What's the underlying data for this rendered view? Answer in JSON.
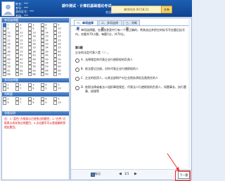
{
  "header": {
    "candidate_lines": [
      "姓名：***",
      "考号：***",
      "身份证号：***",
      "考场：***"
    ],
    "exam_title": "期中测试 · 计算机基础理论考试",
    "exam_subtitle": "考试进行中",
    "timer_text": "剩余时间 00:58:21",
    "button_label": "交卷"
  },
  "left_panel": {
    "section1_title": "单项选择题",
    "section1_items": [
      {
        "label": "1",
        "done": true
      },
      {
        "label": "2",
        "done": false
      },
      {
        "label": "3",
        "done": false
      },
      {
        "label": "4",
        "done": false
      },
      {
        "label": "5",
        "done": false
      },
      {
        "label": "6",
        "done": false
      },
      {
        "label": "7",
        "done": false
      },
      {
        "label": "8",
        "done": false
      },
      {
        "label": "9",
        "done": false
      },
      {
        "label": "10",
        "done": false
      },
      {
        "label": "11",
        "done": false
      },
      {
        "label": "12",
        "done": false
      },
      {
        "label": "13",
        "done": false
      },
      {
        "label": "14",
        "done": false
      },
      {
        "label": "15",
        "done": false
      },
      {
        "label": "16",
        "done": false
      },
      {
        "label": "17",
        "done": false
      },
      {
        "label": "18",
        "done": false
      },
      {
        "label": "19",
        "done": false
      },
      {
        "label": "20",
        "done": false
      },
      {
        "label": "21",
        "done": false
      },
      {
        "label": "22",
        "done": false
      },
      {
        "label": "23",
        "done": false
      },
      {
        "label": "24",
        "done": false
      },
      {
        "label": "25",
        "done": false
      },
      {
        "label": "26",
        "done": false
      },
      {
        "label": "27",
        "done": false
      },
      {
        "label": "28",
        "done": false
      },
      {
        "label": "29",
        "done": false
      },
      {
        "label": "30",
        "done": false
      },
      {
        "label": "31",
        "done": false
      },
      {
        "label": "32",
        "done": false
      },
      {
        "label": "33",
        "done": false
      },
      {
        "label": "34",
        "done": false
      },
      {
        "label": "35",
        "done": false
      },
      {
        "label": "36",
        "done": false
      },
      {
        "label": "37",
        "done": false
      },
      {
        "label": "38",
        "done": false
      },
      {
        "label": "39",
        "done": false
      },
      {
        "label": "40",
        "done": false
      },
      {
        "label": "41",
        "done": false
      },
      {
        "label": "42",
        "done": false
      },
      {
        "label": "43",
        "done": false
      },
      {
        "label": "44",
        "done": false
      },
      {
        "label": "45",
        "done": false
      },
      {
        "label": "46",
        "done": false
      },
      {
        "label": "47",
        "done": false
      },
      {
        "label": "48",
        "done": false
      },
      {
        "label": "49",
        "done": false
      },
      {
        "label": "50",
        "done": false
      },
      {
        "label": "51",
        "done": false
      },
      {
        "label": "52",
        "done": false
      },
      {
        "label": "53",
        "done": false
      },
      {
        "label": "54",
        "done": false
      },
      {
        "label": "55",
        "done": false
      },
      {
        "label": "56",
        "done": false
      },
      {
        "label": "57",
        "done": false
      },
      {
        "label": "58",
        "done": false
      },
      {
        "label": "59",
        "done": false
      },
      {
        "label": "60",
        "done": false
      },
      {
        "label": "61",
        "done": false
      },
      {
        "label": "62",
        "done": false
      },
      {
        "label": "63",
        "done": false
      },
      {
        "label": "64",
        "done": false
      },
      {
        "label": "65",
        "done": false
      },
      {
        "label": "66",
        "done": false
      },
      {
        "label": "67",
        "done": false
      },
      {
        "label": "68",
        "done": false
      },
      {
        "label": "69",
        "done": false
      },
      {
        "label": "70",
        "done": false
      }
    ],
    "section2_title": "多项选择题",
    "section2_items": [
      {
        "label": "1",
        "done": false
      },
      {
        "label": "2",
        "done": false
      },
      {
        "label": "3",
        "done": false
      },
      {
        "label": "4",
        "done": false
      },
      {
        "label": "5",
        "done": false
      },
      {
        "label": "6",
        "done": false
      },
      {
        "label": "7",
        "done": false
      },
      {
        "label": "8",
        "done": false
      },
      {
        "label": "9",
        "done": false
      },
      {
        "label": "10",
        "done": false
      }
    ],
    "section3_title": "判断题",
    "section3_items": [
      {
        "label": "1",
        "done": false
      },
      {
        "label": "2",
        "done": false
      },
      {
        "label": "3",
        "done": false
      },
      {
        "label": "4",
        "done": false
      },
      {
        "label": "5",
        "done": false
      },
      {
        "label": "6",
        "done": false
      },
      {
        "label": "7",
        "done": false
      },
      {
        "label": "8",
        "done": false
      },
      {
        "label": "9",
        "done": false
      },
      {
        "label": "10",
        "done": false
      }
    ],
    "notice_title": "答题说明",
    "notice_text": "注：1.“蓝色”方框表示已经答过的题目；2.“白色”方框表示尚未答过的题目；3.点击题号可以直接跳转到相应题目。"
  },
  "right_panel": {
    "tabs": [
      "一、单项选择题",
      "二、多项选择题",
      "三、判断题"
    ],
    "active_tab": 0,
    "instructions": "一、单项选择题。在备选答案中只有一个是正确的，将其选出并把它的标号写在题后括号内。本题共70小题，每题1分，共70分。",
    "question_number": "第1题",
    "question_stem": "企业的法定代表人是（ ）。",
    "options": [
      {
        "key": "A.",
        "text": "法律规定的代表企业行使职权的负责人"
      },
      {
        "key": "B.",
        "text": "依法登记注册，对外代表企业行使职权的人"
      },
      {
        "key": "C.",
        "text": "企业的投资人，以其全部财产对企业债务承担无限责任的人"
      },
      {
        "key": "D.",
        "text": "依照法律或者法人组织章程规定，代表法人行使职权的负责人，如董事长、执行董事、经理等"
      }
    ],
    "mark_label": "标记",
    "page_indicator": "1/1",
    "prev_symbol": "◀",
    "next_symbol": "▶",
    "next_button": "下一题"
  }
}
